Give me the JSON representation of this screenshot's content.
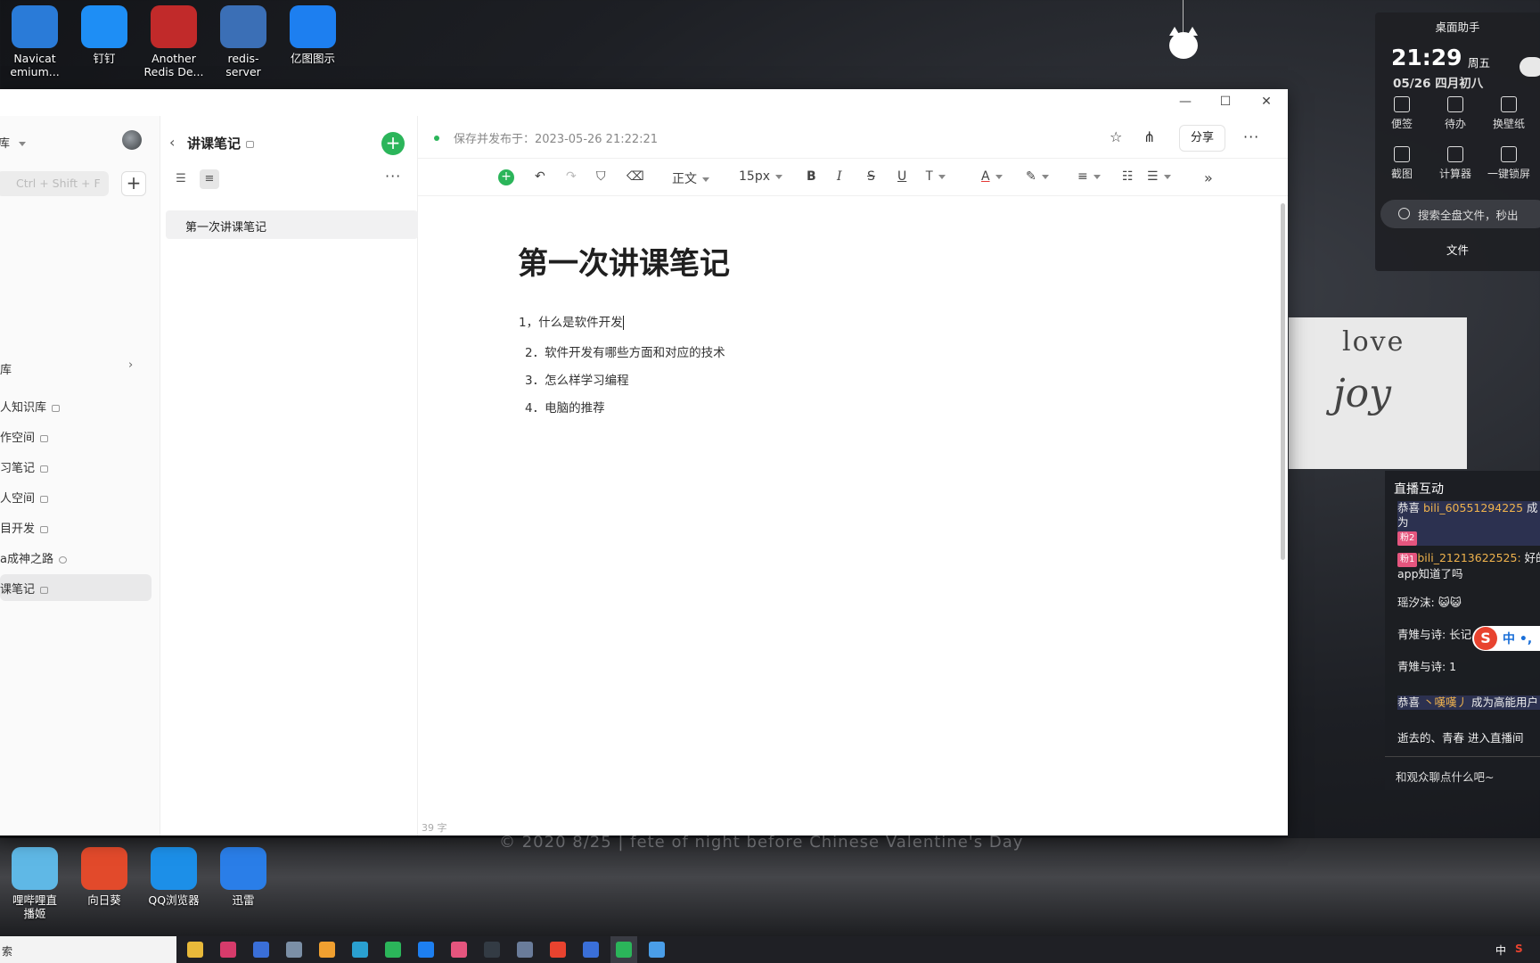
{
  "desktop": {
    "icons_top": [
      {
        "label": "Navicat\nemium...",
        "icon": "navicat-icon",
        "color": "#2a7bd8"
      },
      {
        "label": "钉钉",
        "icon": "dingtalk-icon",
        "color": "#1e8ef5"
      },
      {
        "label": "Another\nRedis De...",
        "icon": "redis-desktop-icon",
        "color": "#c12a2a"
      },
      {
        "label": "redis-\nserver",
        "icon": "redis-server-icon",
        "color": "#3b6fb6"
      },
      {
        "label": "亿图图示",
        "icon": "edraw-icon",
        "color": "#1d7ff0"
      }
    ],
    "icons_bottom": [
      {
        "label": "哩哔哩直\n播姬",
        "icon": "bilibili-live-icon",
        "color": "#5fb8e6"
      },
      {
        "label": "向日葵",
        "icon": "sunlogin-icon",
        "color": "#e24a2b"
      },
      {
        "label": "QQ浏览器",
        "icon": "qq-browser-icon",
        "color": "#1c8fe8"
      },
      {
        "label": "迅雷",
        "icon": "thunder-icon",
        "color": "#2a7ee8"
      }
    ],
    "watermark": "© 2020 8/25 | fete of night before Chinese Valentine's Day",
    "love_word": "love",
    "joy_word": "joy"
  },
  "widget": {
    "title": "桌面助手",
    "time": "21:29",
    "weekday": "周五",
    "date": "05/26 四月初八",
    "grid": [
      {
        "label": "便签",
        "icon": "sticky-note-icon"
      },
      {
        "label": "待办",
        "icon": "todo-icon"
      },
      {
        "label": "换壁纸",
        "icon": "wallpaper-icon"
      },
      {
        "label": "截图",
        "icon": "screenshot-icon"
      },
      {
        "label": "计算器",
        "icon": "calculator-icon"
      },
      {
        "label": "一键锁屏",
        "icon": "lock-screen-icon"
      }
    ],
    "search": "搜索全盘文件，秒出",
    "file_label": "文件"
  },
  "live": {
    "title": "直播互动",
    "messages": [
      {
        "prefix": "恭喜 ",
        "name": "bili_60551294225",
        "suffix": " 成为",
        "badge": "粉2"
      },
      {
        "badge": "粉1",
        "name": "bili_21213622525:",
        "text": " 好的app知道了吗"
      },
      {
        "text": "瑶汐沫: 😺😺"
      },
      {
        "text": "青雉与诗: 长记"
      },
      {
        "text": "青雉与诗: 1"
      },
      {
        "prefix": "恭喜 ",
        "name": "丶嘆嘆丿",
        "suffix": " 成为高能用户"
      },
      {
        "text": "逝去的、青春",
        "muted": " 进入直播间"
      }
    ],
    "input_placeholder": "和观众聊点什么吧~",
    "ime": "中 •,"
  },
  "window": {
    "controls": {
      "minimize": "—",
      "maximize": "☐",
      "close": "✕"
    }
  },
  "sidebar": {
    "top_label": "库",
    "search_placeholder": "Ctrl + Shift + F",
    "add": "+",
    "section": "库",
    "items": [
      {
        "label": "人知识库",
        "locked": true
      },
      {
        "label": "作空间",
        "locked": true
      },
      {
        "label": "习笔记",
        "locked": true
      },
      {
        "label": "人空间",
        "locked": true
      },
      {
        "label": "目开发",
        "locked": true
      },
      {
        "label": "a成神之路",
        "locked": false
      },
      {
        "label": "课笔记",
        "locked": true,
        "active": true
      }
    ]
  },
  "notelist": {
    "title": "讲课笔记",
    "add": "+",
    "more": "···",
    "items": [
      "第一次讲课笔记"
    ]
  },
  "editor": {
    "saved_text": "保存并发布于：2023-05-26 21:22:21",
    "share": "分享",
    "more": "···",
    "toolbar": {
      "paragraph": "正文",
      "font_size": "15px",
      "bold": "B",
      "italic": "I",
      "strike": "S",
      "underline": "U",
      "text_color": "A",
      "expand": "»"
    },
    "title": "第一次讲课笔记",
    "lines": [
      "1，什么是软件开发",
      "2．软件开发有哪些方面和对应的技术",
      "3．怎么样学习编程",
      "4．电脑的推荐"
    ],
    "word_count": "39 字"
  },
  "taskbar": {
    "search": "索",
    "tray": {
      "lang": "中"
    }
  }
}
